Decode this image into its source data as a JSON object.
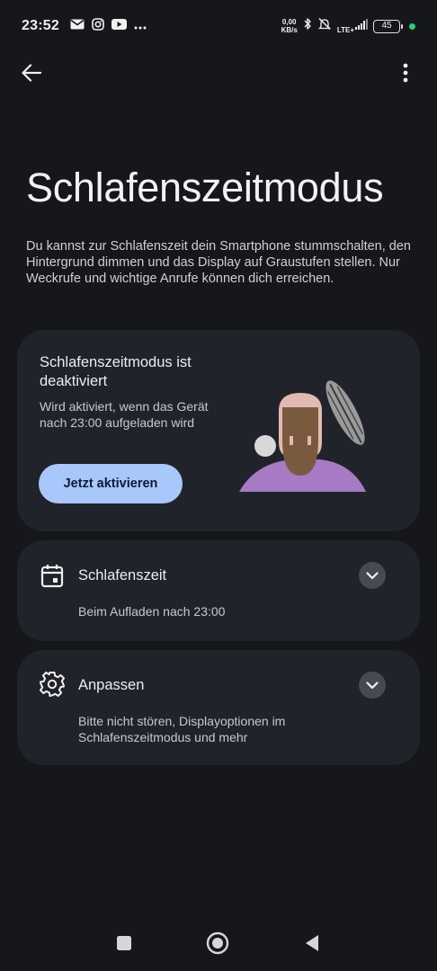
{
  "status_bar": {
    "time": "23:52",
    "net_speed_value": "0,00",
    "net_speed_unit": "KB/s",
    "network_type": "LTE+",
    "battery": "45",
    "left_icons": [
      "mail-icon",
      "instagram-icon",
      "youtube-icon",
      "more-notifications-icon"
    ],
    "right_icons": [
      "bluetooth-icon",
      "silent-icon",
      "signal-icon"
    ]
  },
  "app_bar": {
    "back_icon": "arrow-left-icon",
    "menu_icon": "more-vert-icon"
  },
  "page": {
    "title": "Schlafenszeitmodus",
    "description": "Du kannst zur Schlafenszeit dein Smartphone stummschalten, den Hintergrund dimmen und das Display auf Graustufen stellen. Nur Weckrufe und wichtige Anrufe können dich erreichen."
  },
  "status_card": {
    "title": "Schlafenszeitmodus ist deaktiviert",
    "subtitle": "Wird aktiviert, wenn das Gerät nach 23:00 aufgeladen wird",
    "button_label": "Jetzt aktivieren"
  },
  "schedule_card": {
    "icon": "calendar-icon",
    "title": "Schlafenszeit",
    "subtitle": "Beim Aufladen nach 23:00"
  },
  "customize_card": {
    "icon": "gear-icon",
    "title": "Anpassen",
    "subtitle": "Bitte nicht stören, Displayoptionen im Schlafenszeitmodus und mehr"
  },
  "colors": {
    "background": "#16171b",
    "card": "#21232a",
    "accent_button": "#a8c7fa",
    "illustration_shirt": "#a77ac4",
    "illustration_hair": "#e3b9b3",
    "illustration_face": "#7a5a3e"
  }
}
